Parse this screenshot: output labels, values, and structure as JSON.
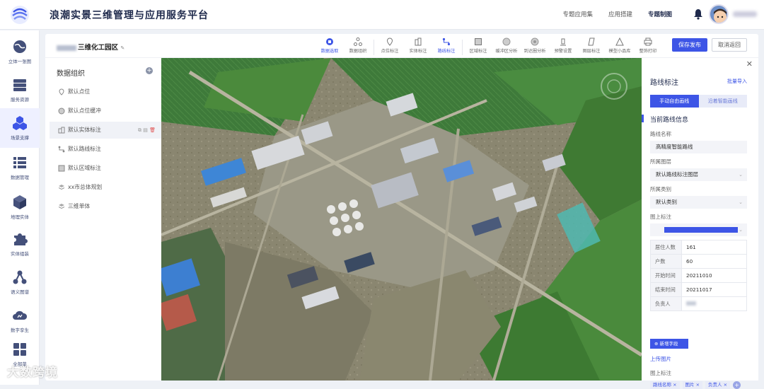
{
  "app": {
    "title": "浪潮实景三维管理与应用服务平台"
  },
  "topnav": [
    "专题应用集",
    "应用搭建",
    "专题制图"
  ],
  "topnav_active": "专题制图",
  "leftnav": [
    {
      "label": "立体一张图",
      "icon": "globe-icon"
    },
    {
      "label": "服务资源",
      "icon": "server-icon"
    },
    {
      "label": "场景支撑",
      "icon": "hexagons-icon"
    },
    {
      "label": "数据管理",
      "icon": "list-icon"
    },
    {
      "label": "地理实体",
      "icon": "cube-icon"
    },
    {
      "label": "实体组装",
      "icon": "puzzle-icon"
    },
    {
      "label": "语义图谱",
      "icon": "graph-icon"
    },
    {
      "label": "数字孪生",
      "icon": "cloud-icon"
    },
    {
      "label": "全部菜",
      "icon": "grid-icon"
    }
  ],
  "project": {
    "name": "三维化工园区"
  },
  "toolbar": [
    {
      "label": "数据选取",
      "icon": "data-select-icon"
    },
    {
      "label": "数据组织",
      "icon": "data-org-icon"
    },
    {
      "label": "点位标注",
      "icon": "pin-icon"
    },
    {
      "label": "实体标注",
      "icon": "building-icon"
    },
    {
      "label": "路线标注",
      "icon": "route-icon"
    },
    {
      "label": "区域标注",
      "icon": "area-icon"
    },
    {
      "label": "缓冲区分析",
      "icon": "buffer-icon"
    },
    {
      "label": "到达圈分析",
      "icon": "reach-icon"
    },
    {
      "label": "预警设置",
      "icon": "warning-icon"
    },
    {
      "label": "图层标注",
      "icon": "layer-icon"
    },
    {
      "label": "模型小品库",
      "icon": "model-icon"
    },
    {
      "label": "整饰打印",
      "icon": "print-icon"
    }
  ],
  "buttons": {
    "publish": "保存发布",
    "back": "取消返回"
  },
  "datapanel": {
    "title": "数据组织",
    "items": [
      {
        "label": "默认点位",
        "icon": "pin-icon"
      },
      {
        "label": "默认点位缓冲",
        "icon": "buffer-icon"
      },
      {
        "label": "默认实体标注",
        "icon": "building-icon"
      },
      {
        "label": "默认路线标注",
        "icon": "route-icon"
      },
      {
        "label": "默认区域标注",
        "icon": "area-icon"
      },
      {
        "label": "xx市总体规划",
        "icon": "layers-icon"
      },
      {
        "label": "三维单体",
        "icon": "layers-icon"
      }
    ]
  },
  "rpanel": {
    "title": "路线标注",
    "import": "批量导入",
    "mode_on": "手动自由画线",
    "mode_off": "沿着智能画线",
    "section": "当前路线信息",
    "name_label": "路线名称",
    "name_value": "高精度智能路线",
    "layer_label": "所属图层",
    "layer_value": "默认路线标注图层",
    "category_label": "所属类别",
    "category_value": "默认类别",
    "marker_label": "图上标注",
    "marker_color": "#3d55e6",
    "table": [
      {
        "k": "居住人数",
        "v": "161"
      },
      {
        "k": "户数",
        "v": "60"
      },
      {
        "k": "开始时间",
        "v": "20211010"
      },
      {
        "k": "结束时间",
        "v": "20211017"
      },
      {
        "k": "负责人",
        "v": ""
      }
    ],
    "add_field": "新增字段",
    "upload": "上传图片",
    "map_label": "图上标注",
    "tags": [
      "路线名称",
      "图片",
      "负责人"
    ]
  },
  "watermark": "大数跨境"
}
